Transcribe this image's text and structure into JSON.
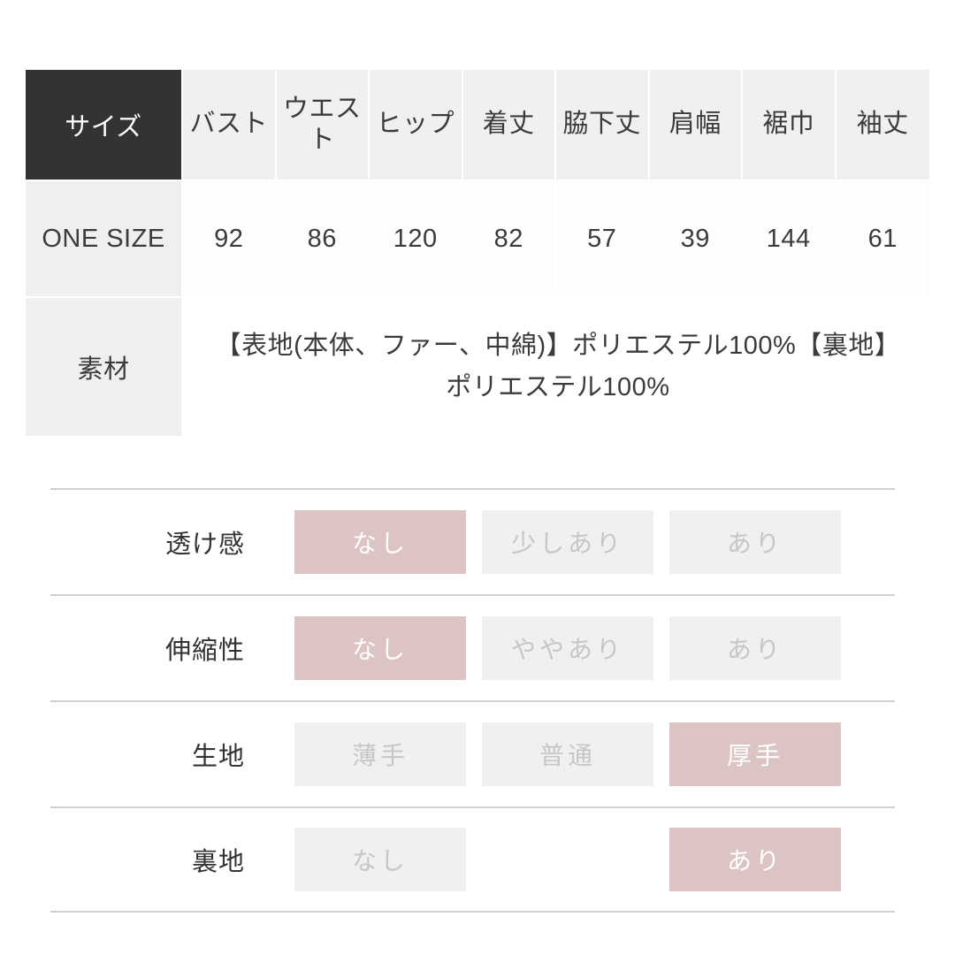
{
  "size_table": {
    "headers": [
      "サイズ",
      "バスト",
      "ウエスト",
      "ヒップ",
      "着丈",
      "脇下丈",
      "肩幅",
      "裾巾",
      "袖丈"
    ],
    "rows": [
      {
        "label": "ONE SIZE",
        "values": [
          "92",
          "86",
          "120",
          "82",
          "57",
          "39",
          "144",
          "61"
        ]
      }
    ],
    "material": {
      "label": "素材",
      "text": "【表地(本体、ファー、中綿)】ポリエステル100%【裏地】ポリエステル100%"
    }
  },
  "attributes": {
    "rows": [
      {
        "label": "透け感",
        "options": [
          {
            "text": "なし",
            "state": "on"
          },
          {
            "text": "少しあり",
            "state": "off"
          },
          {
            "text": "あり",
            "state": "off"
          }
        ]
      },
      {
        "label": "伸縮性",
        "options": [
          {
            "text": "なし",
            "state": "on"
          },
          {
            "text": "ややあり",
            "state": "off"
          },
          {
            "text": "あり",
            "state": "off"
          }
        ]
      },
      {
        "label": "生地",
        "options": [
          {
            "text": "薄手",
            "state": "off"
          },
          {
            "text": "普通",
            "state": "off"
          },
          {
            "text": "厚手",
            "state": "on"
          }
        ]
      },
      {
        "label": "裏地",
        "options": [
          {
            "text": "なし",
            "state": "off"
          },
          {
            "text": "",
            "state": "blank"
          },
          {
            "text": "あり",
            "state": "on"
          }
        ]
      }
    ]
  },
  "colors": {
    "selected_pill": "#ddc4c4",
    "unselected_pill": "#f0f0f0",
    "header_dark": "#333333",
    "header_light": "#f0f0f0",
    "divider": "#cfcfcf"
  }
}
